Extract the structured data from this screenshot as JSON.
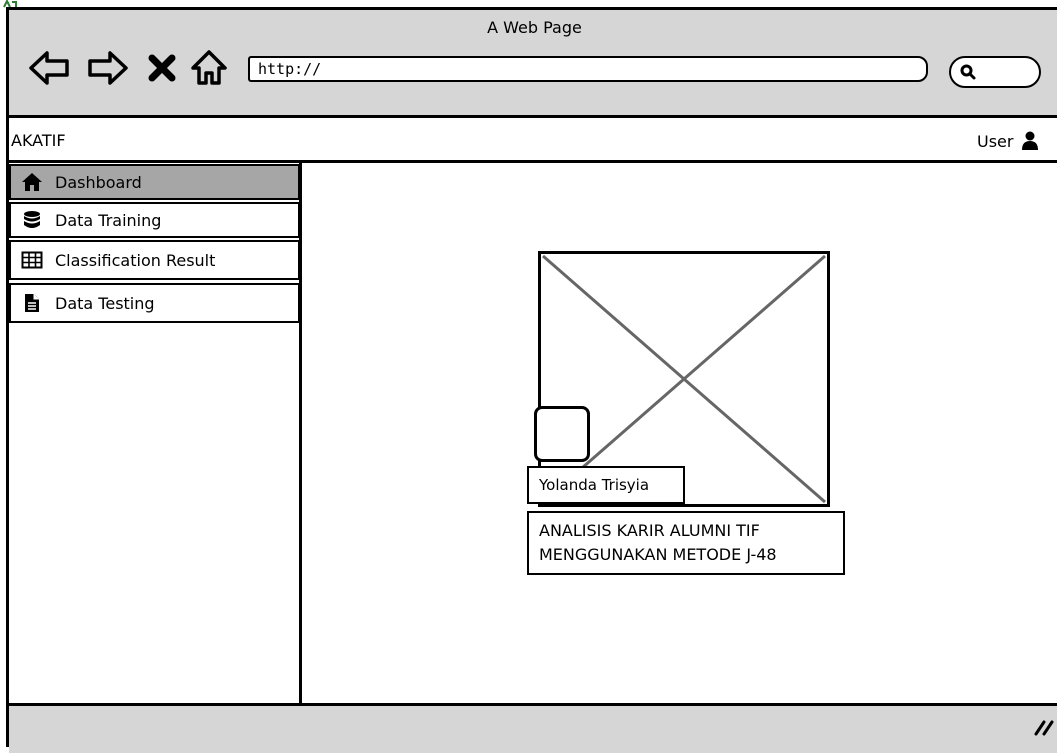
{
  "browser": {
    "window_title": "A Web Page",
    "url": "http://",
    "nav_icons": [
      "back-arrow-icon",
      "forward-arrow-icon",
      "stop-icon",
      "home-icon"
    ],
    "search_icon": "search-icon"
  },
  "header": {
    "app_name": "AKATIF",
    "user_label": "User",
    "user_icon": "user-icon"
  },
  "sidebar": {
    "items": [
      {
        "label": "Dashboard",
        "icon": "home-icon",
        "active": true
      },
      {
        "label": "Data Training",
        "icon": "database-icon",
        "active": false
      },
      {
        "label": "Classification Result",
        "icon": "table-icon",
        "active": false
      },
      {
        "label": "Data Testing",
        "icon": "file-icon",
        "active": false
      }
    ]
  },
  "main": {
    "author_name": "Yolanda Trisyia",
    "thesis_title_line1": "ANALISIS KARIR ALUMNI TIF",
    "thesis_title_line2": "MENGGUNAKAN METODE J-48"
  },
  "colors": {
    "chrome": "#d6d6d6",
    "active_item": "#a6a6a6",
    "border": "#000000",
    "placeholder_lines": "#666666"
  }
}
